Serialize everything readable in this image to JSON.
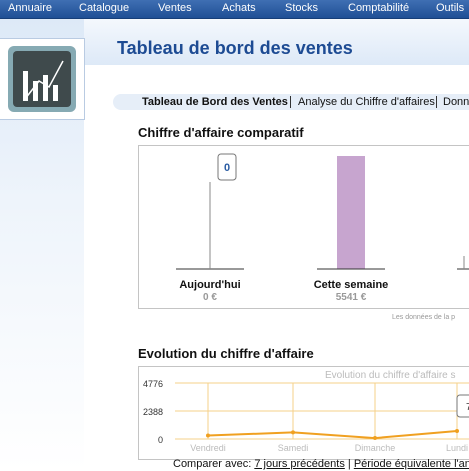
{
  "menu": {
    "items": [
      "Annuaire",
      "Catalogue",
      "Ventes",
      "Achats",
      "Stocks",
      "Comptabilité",
      "Outils"
    ]
  },
  "header": {
    "title": "Tableau de bord des ventes"
  },
  "tabs": [
    {
      "label": "Tableau de Bord des Ventes",
      "active": true
    },
    {
      "label": "Analyse du Chiffre d'affaires",
      "active": false
    },
    {
      "label": "Donn",
      "active": false
    }
  ],
  "comparatif": {
    "title": "Chiffre d'affaire comparatif",
    "note": "Les données de la p",
    "tooltip_value": "0",
    "chart_data": {
      "type": "bar",
      "categories": [
        "Aujourd'hui",
        "Cette semaine"
      ],
      "value_labels": [
        "0 €",
        "5541 €"
      ],
      "values": [
        0,
        5541
      ],
      "ylim": [
        0,
        5541
      ]
    }
  },
  "evolution": {
    "title": "Evolution du chiffre d'affaire",
    "chart_title": "Evolution du chiffre d'affaire s",
    "tooltip_value": "7",
    "chart_data": {
      "type": "line",
      "x": [
        "Vendredi",
        "Samedi",
        "Dimanche",
        "Lundi"
      ],
      "series": [
        {
          "values": [
            300,
            560,
            80,
            680
          ]
        }
      ],
      "y_ticks": [
        "4776",
        "2388",
        "0"
      ],
      "ylim": [
        0,
        4776
      ],
      "colors": {
        "line": "#f0a020",
        "grid": "#f5d08a"
      }
    }
  },
  "compare": {
    "prefix": "Comparer avec:",
    "link1": "7 jours précédents",
    "separator": "|",
    "link2": "Période équivalente l'an pa"
  },
  "colors": {
    "menubar": "#2a5ca3",
    "title": "#1d4b93",
    "bar": "#c7a5cf"
  }
}
